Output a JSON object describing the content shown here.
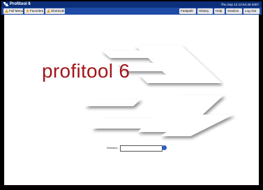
{
  "window": {
    "title": "Profitool 6",
    "datetime": "Thu Sep 13 12:54:49 2007"
  },
  "menu": {
    "left": [
      {
        "label": "Full Menu",
        "icon": "menu-icon"
      },
      {
        "label": "Favorites",
        "icon": "star-icon"
      },
      {
        "label": "Shortcuts",
        "icon": "shortcut-icon"
      }
    ],
    "right": [
      {
        "label": "Fastpath"
      },
      {
        "label": "History"
      },
      {
        "label": "Help"
      },
      {
        "label": "Session"
      },
      {
        "label": "Log Out"
      }
    ]
  },
  "logo": {
    "text": "profitool 6",
    "color": "#a1161b"
  },
  "search": {
    "label": "Selection",
    "value": "",
    "go_icon": "go-arrow-icon"
  },
  "colors": {
    "titlebar": "#0c2f7a",
    "menubar": "#1e4ba6",
    "accent": "#2f5fc1"
  }
}
